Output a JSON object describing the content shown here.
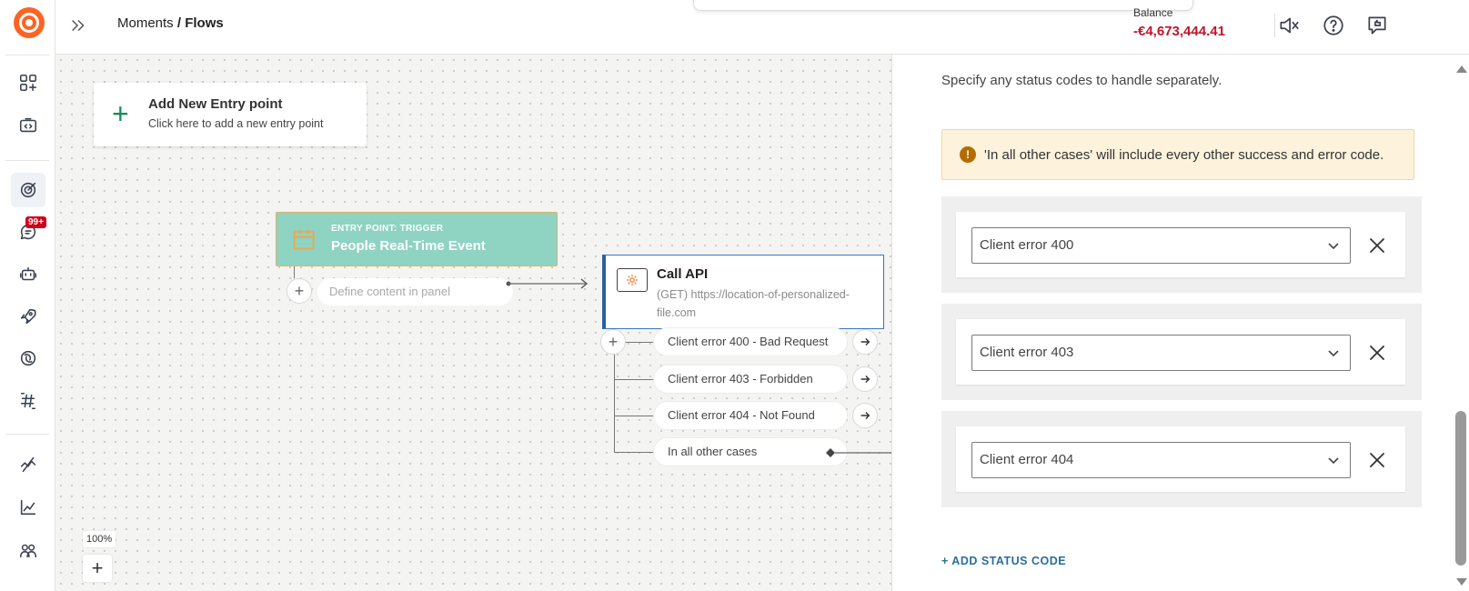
{
  "header": {
    "breadcrumb_parent": "Moments",
    "breadcrumb_sep": " / ",
    "breadcrumb_current": "Flows",
    "balance_label": "Balance",
    "balance_value": "-€4,673,444.41"
  },
  "sidebar": {
    "badge": "99+"
  },
  "canvas": {
    "entry_point": {
      "title": "Add New Entry point",
      "subtitle": "Click here to add a new entry point"
    },
    "trigger": {
      "label": "ENTRY POINT: TRIGGER",
      "name": "People Real-Time Event",
      "define_placeholder": "Define content in panel"
    },
    "call_api": {
      "title": "Call API",
      "url": "(GET) https://location-of-personalized-file.com"
    },
    "branches": [
      "Client error 400 - Bad Request",
      "Client error 403 - Forbidden",
      "Client error 404 - Not Found",
      "In all other cases"
    ],
    "zoom": "100%"
  },
  "panel": {
    "description": "Specify any status codes to handle separately.",
    "warning": "'In all other cases' will include every other success and error code.",
    "status_codes": [
      "Client error 400",
      "Client error 403",
      "Client error 404"
    ],
    "add_label": "+ ADD STATUS CODE"
  },
  "colors": {
    "brand": "#fc6423",
    "balance": "#c1152b",
    "trigger_bg": "#8fd3c2",
    "api_border": "#2b5fa0",
    "link": "#2a6e9b",
    "warning_bg": "#fdf3dc"
  }
}
